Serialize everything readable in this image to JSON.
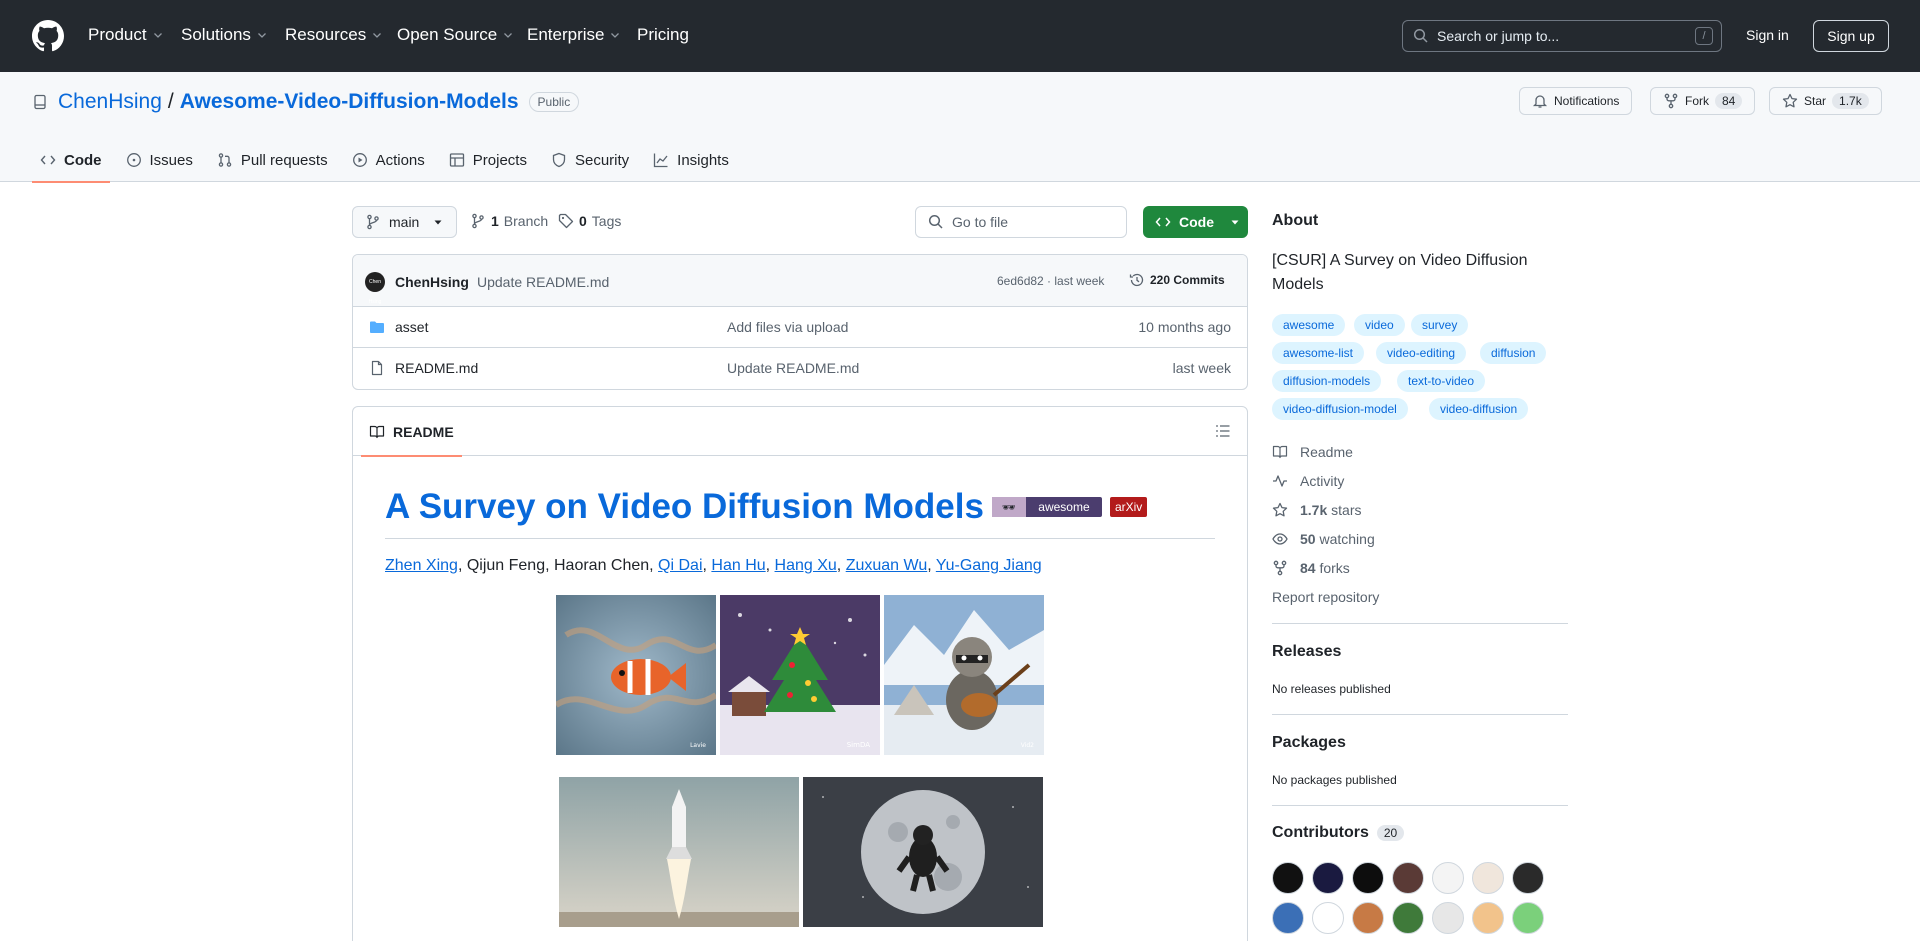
{
  "header": {
    "nav": [
      {
        "label": "Product",
        "has_menu": true
      },
      {
        "label": "Solutions",
        "has_menu": true
      },
      {
        "label": "Resources",
        "has_menu": true
      },
      {
        "label": "Open Source",
        "has_menu": true
      },
      {
        "label": "Enterprise",
        "has_menu": true
      },
      {
        "label": "Pricing",
        "has_menu": false
      }
    ],
    "search_placeholder": "Search or jump to...",
    "search_shortcut": "/",
    "sign_in": "Sign in",
    "sign_up": "Sign up"
  },
  "repo": {
    "owner": "ChenHsing",
    "separator": "/",
    "name": "Awesome-Video-Diffusion-Models",
    "visibility": "Public",
    "notifications_label": "Notifications",
    "fork_label": "Fork",
    "fork_count": "84",
    "star_label": "Star",
    "star_count": "1.7k",
    "tabs": [
      {
        "label": "Code",
        "icon": "code-icon",
        "active": true
      },
      {
        "label": "Issues",
        "icon": "issue-icon",
        "active": false
      },
      {
        "label": "Pull requests",
        "icon": "pull-request-icon",
        "active": false
      },
      {
        "label": "Actions",
        "icon": "play-icon",
        "active": false
      },
      {
        "label": "Projects",
        "icon": "table-icon",
        "active": false
      },
      {
        "label": "Security",
        "icon": "shield-icon",
        "active": false
      },
      {
        "label": "Insights",
        "icon": "graph-icon",
        "active": false
      }
    ]
  },
  "code": {
    "branch": "main",
    "branch_count": "1",
    "branch_label": "Branch",
    "tag_count": "0",
    "tag_label": "Tags",
    "goto_placeholder": "Go to file",
    "code_button": "Code",
    "latest_commit": {
      "author": "ChenHsing",
      "avatar_text": "Chen Hsing",
      "message": "Update README.md",
      "sha_time": "6ed6d82 · last week",
      "commits": "220 Commits"
    },
    "files": [
      {
        "type": "folder",
        "name": "asset",
        "message": "Add files via upload",
        "date": "10 months ago"
      },
      {
        "type": "file",
        "name": "README.md",
        "message": "Update README.md",
        "date": "last week"
      }
    ]
  },
  "readme": {
    "tab_label": "README",
    "title": "A Survey on Video Diffusion Models",
    "badge_awesome": "awesome",
    "badge_arxiv": "arXiv",
    "authors": [
      {
        "name": "Zhen Xing",
        "link": true,
        "sep": ", "
      },
      {
        "name": "Qijun Feng",
        "link": false,
        "sep": ", "
      },
      {
        "name": "Haoran Chen",
        "link": false,
        "sep": ", "
      },
      {
        "name": "Qi Dai",
        "link": true,
        "sep": ", "
      },
      {
        "name": "Han Hu",
        "link": true,
        "sep": ", "
      },
      {
        "name": "Hang Xu",
        "link": true,
        "sep": ", "
      },
      {
        "name": "Zuxuan Wu",
        "link": true,
        "sep": ", "
      },
      {
        "name": "Yu-Gang Jiang",
        "link": true,
        "sep": ""
      }
    ],
    "demo_captions": [
      "Lavie",
      "SimDA",
      "Vid2",
      "",
      ""
    ]
  },
  "about": {
    "heading": "About",
    "description": "[CSUR] A Survey on Video Diffusion Models",
    "topics": [
      "awesome",
      "video",
      "survey",
      "awesome-list",
      "video-editing",
      "diffusion",
      "diffusion-models",
      "text-to-video",
      "video-diffusion-model",
      "video-diffusion"
    ],
    "links": [
      {
        "icon": "book-icon",
        "bold": "",
        "text": "Readme"
      },
      {
        "icon": "pulse-icon",
        "bold": "",
        "text": "Activity"
      },
      {
        "icon": "star-icon",
        "bold": "1.7k",
        "text": "stars"
      },
      {
        "icon": "eye-icon",
        "bold": "50",
        "text": "watching"
      },
      {
        "icon": "fork-icon",
        "bold": "84",
        "text": "forks"
      }
    ],
    "report": "Report repository"
  },
  "releases": {
    "heading": "Releases",
    "note": "No releases published"
  },
  "packages": {
    "heading": "Packages",
    "note": "No packages published"
  },
  "contributors": {
    "heading": "Contributors",
    "count": "20",
    "avatar_colors": [
      "#111111",
      "#1a1a40",
      "#0d0d0d",
      "#5a3a36",
      "#f4f4f4",
      "#f0e6dc",
      "#2a2a2a",
      "#3b6fb6",
      "#ffffff",
      "#c77a45",
      "#3f7a3a",
      "#e7e7e7",
      "#f2c38b",
      "#7bd07b"
    ]
  },
  "colors": {
    "header_bg": "#24292f",
    "link": "#0969da",
    "primary_green": "#1f883d",
    "active_tab_underline": "#fd8c73"
  }
}
